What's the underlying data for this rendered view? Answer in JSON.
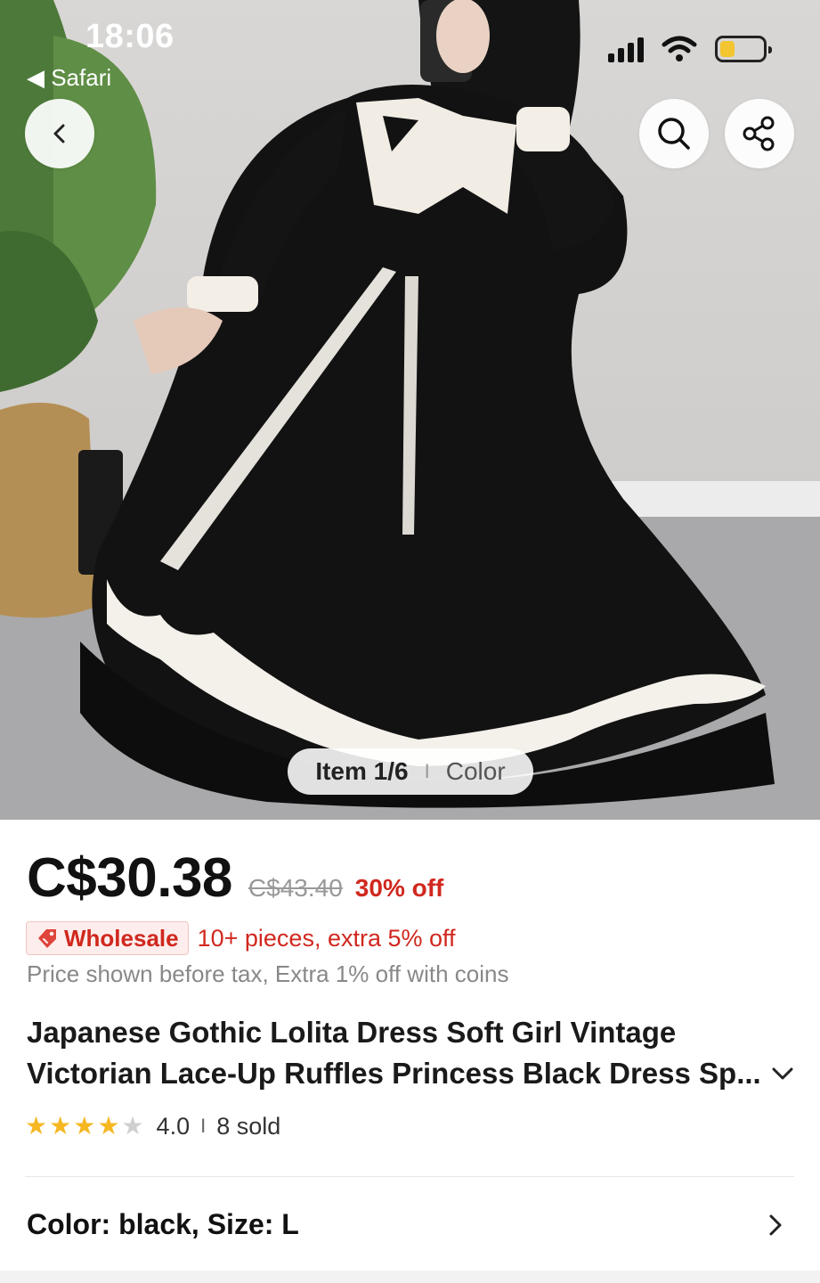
{
  "status_bar": {
    "time": "18:06",
    "back_app": "◀ Safari"
  },
  "header": {
    "back_icon": "chevron-left-icon",
    "search_icon": "search-icon",
    "share_icon": "share-icon"
  },
  "gallery": {
    "counter": "Item 1/6",
    "divider": "I",
    "tab": "Color"
  },
  "price": {
    "current": "C$30.38",
    "original": "C$43.40",
    "discount": "30% off"
  },
  "wholesale": {
    "tag": "Wholesale",
    "offer": "10+ pieces, extra 5% off"
  },
  "tax_note": "Price shown before tax, Extra 1% off with coins",
  "product": {
    "title_line1": "Japanese Gothic Lolita Dress Soft Girl Vintage",
    "title_line2": "Victorian Lace-Up Ruffles Princess Black Dress Sp..."
  },
  "rating": {
    "value": "4.0",
    "stars_filled": 4,
    "stars_total": 5,
    "divider": "I",
    "sold": "8 sold"
  },
  "variant": {
    "label": "Color: black, Size: L"
  },
  "colors": {
    "accent_red": "#d0281e",
    "star_gold": "#f5b823",
    "star_gray": "#cfcfcf"
  }
}
